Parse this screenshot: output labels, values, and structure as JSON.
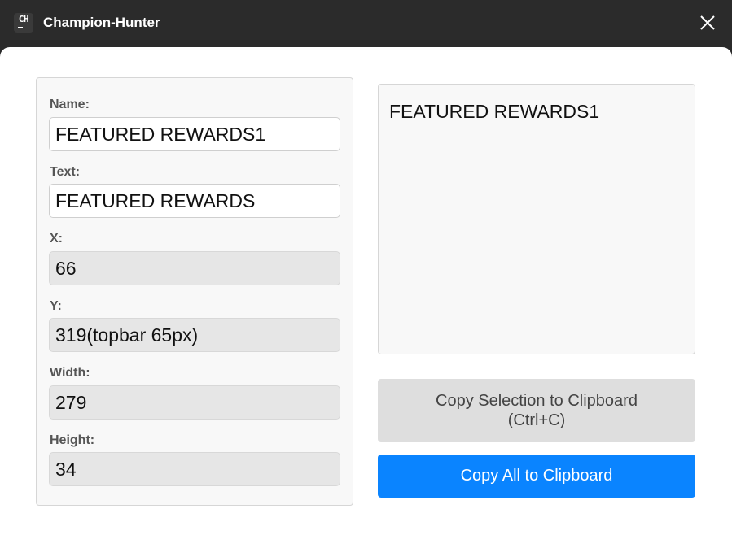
{
  "window": {
    "app_icon_text": "CH",
    "title": "Champion-Hunter"
  },
  "form": {
    "name_label": "Name:",
    "name_value": "FEATURED REWARDS1",
    "text_label": "Text:",
    "text_value": "FEATURED REWARDS",
    "x_label": "X:",
    "x_value": "66",
    "y_label": "Y:",
    "y_value": "319(topbar 65px)",
    "width_label": "Width:",
    "width_value": "279",
    "height_label": "Height:",
    "height_value": "34"
  },
  "preview": {
    "items": [
      "FEATURED REWARDS1"
    ]
  },
  "actions": {
    "copy_selection_line1": "Copy Selection to Clipboard",
    "copy_selection_line2": "(Ctrl+C)",
    "copy_all": "Copy All to Clipboard"
  },
  "colors": {
    "titlebar": "#2b2b2b",
    "primary": "#0a84ff",
    "secondary_button": "#dedede"
  }
}
